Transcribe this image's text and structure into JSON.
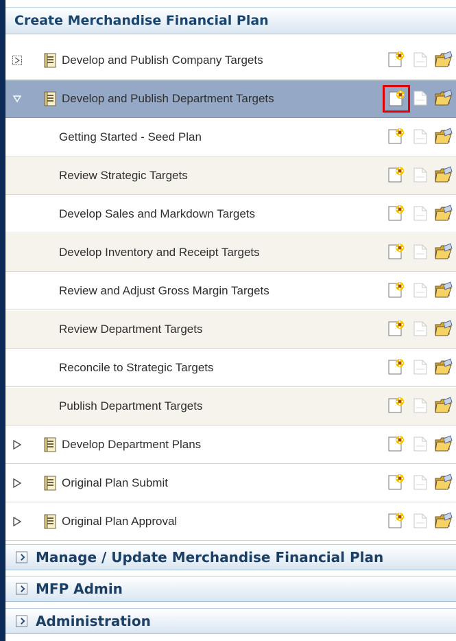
{
  "main_panel": {
    "title": "Create Merchandise Financial Plan",
    "items": [
      {
        "label": "Develop and Publish Company Targets",
        "level": "parent",
        "state": "collapsed-pending",
        "background": "white"
      },
      {
        "label": "Develop and Publish Department Targets",
        "level": "parent",
        "state": "expanded",
        "background": "selected",
        "highlighted_action": "new"
      },
      {
        "label": "Getting Started - Seed Plan",
        "level": "child",
        "background": "white"
      },
      {
        "label": "Review Strategic Targets",
        "level": "child",
        "background": "beige"
      },
      {
        "label": "Develop Sales and Markdown Targets",
        "level": "child",
        "background": "white"
      },
      {
        "label": "Develop Inventory and Receipt Targets",
        "level": "child",
        "background": "beige"
      },
      {
        "label": "Review and Adjust Gross Margin Targets",
        "level": "child",
        "background": "white"
      },
      {
        "label": "Review Department Targets",
        "level": "child",
        "background": "beige"
      },
      {
        "label": "Reconcile to Strategic Targets",
        "level": "child",
        "background": "white"
      },
      {
        "label": "Publish Department Targets",
        "level": "child",
        "background": "beige"
      },
      {
        "label": "Develop Department Plans",
        "level": "parent",
        "state": "collapsed",
        "background": "white"
      },
      {
        "label": "Original Plan Submit",
        "level": "parent",
        "state": "collapsed",
        "background": "white"
      },
      {
        "label": "Original Plan Approval",
        "level": "parent",
        "state": "collapsed",
        "background": "white"
      }
    ],
    "action_icons": [
      "new-workbook-icon",
      "saved-document-icon",
      "open-folder-icon"
    ]
  },
  "accordions": [
    {
      "title": "Manage / Update Merchandise Financial Plan"
    },
    {
      "title": "MFP Admin"
    },
    {
      "title": "Administration"
    }
  ],
  "colors": {
    "header_text": "#18456f",
    "selected_row": "#95a9c7",
    "beige_row": "#f5f3eb",
    "highlight_border": "#e00000",
    "left_rail": "#0b2a57"
  }
}
